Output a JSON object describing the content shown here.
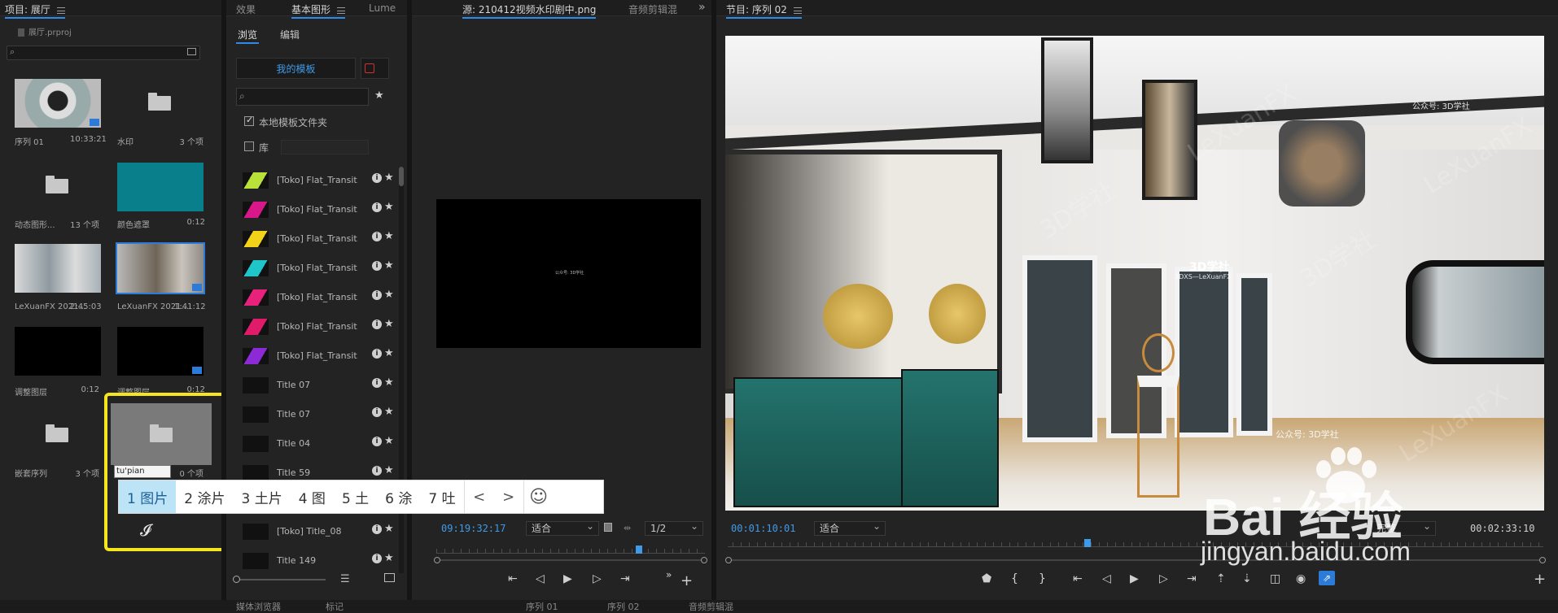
{
  "project_panel": {
    "title": "项目: 展厅",
    "file": "展厅.prproj",
    "items": [
      {
        "name": "序列 01",
        "meta": "10:33:21"
      },
      {
        "name": "水印",
        "meta": "3 个项"
      },
      {
        "name": "动态图形...",
        "meta": "13 个项"
      },
      {
        "name": "颜色遮罩",
        "meta": "0:12"
      },
      {
        "name": "LeXuanFX 2021...",
        "meta": "2:45:03"
      },
      {
        "name": "LeXuanFX 2021...",
        "meta": "1:41:12"
      },
      {
        "name": "调整图层",
        "meta": "0:12"
      },
      {
        "name": "调整图层",
        "meta": "0:12"
      },
      {
        "name": "嵌套序列",
        "meta": "3 个项"
      },
      {
        "name": "",
        "meta": "0 个项"
      }
    ],
    "rename_value": "tu'pian"
  },
  "ime": {
    "candidates": [
      "1 图片",
      "2 涂片",
      "3 土片",
      "4 图",
      "5 土",
      "6 涂",
      "7 吐"
    ],
    "prev": "<",
    "next": ">",
    "emoji": "☺"
  },
  "effects_panel": {
    "tabs": [
      "效果",
      "基本图形",
      "Lume"
    ],
    "subtabs": [
      "浏览",
      "编辑"
    ],
    "my_templates": "我的模板",
    "local_folder_label": "本地模板文件夹",
    "library_label": "库",
    "templates": [
      {
        "name": "[Toko] Flat_Transit...",
        "color": "#b8e23a"
      },
      {
        "name": "[Toko] Flat_Transit...",
        "color": "#d8188a"
      },
      {
        "name": "[Toko] Flat_Transit...",
        "color": "#f3d21a"
      },
      {
        "name": "[Toko] Flat_Transit...",
        "color": "#1fc6c9"
      },
      {
        "name": "[Toko] Flat_Transit...",
        "color": "#e8227c"
      },
      {
        "name": "[Toko] Flat_Transit...",
        "color": "#e01c6a"
      },
      {
        "name": "[Toko] Flat_Transit...",
        "color": "#8c2ad8"
      },
      {
        "name": "Title 07",
        "color": "#111111"
      },
      {
        "name": "Title 07",
        "color": "#111111"
      },
      {
        "name": "Title 04",
        "color": "#111111"
      },
      {
        "name": "Title 59",
        "color": "#111111"
      }
    ],
    "templates_bottom": [
      {
        "name": "[Toko] Title_08",
        "color": "#111111"
      },
      {
        "name": "Title 149",
        "color": "#111111"
      }
    ]
  },
  "source_monitor": {
    "tab": "源: 210412视频水印剧中.png",
    "tab2": "音频剪辑混",
    "video_caption": "公众号: 3D学社",
    "timecode": "09:19:32:17",
    "fit": "适合",
    "page": "1/2"
  },
  "program_monitor": {
    "title": "节目: 序列 02",
    "timecode": "00:01:10:01",
    "fit": "适合",
    "quality": "完整",
    "duration": "00:02:33:10",
    "watermark_brand": "LeXuanFX",
    "watermark_cn": "3D学社",
    "watermark_public": "公众号: 3D学社",
    "logo_main": "3D学社",
    "logo_sub": "3DXS—LeXuanFX"
  },
  "baidu": {
    "logo": "Bai  经验",
    "url": "jingyan.baidu.com"
  },
  "bottom_tabs": [
    "媒体浏览器",
    "标记",
    "序列 01",
    "序列 02",
    "音频剪辑混"
  ]
}
